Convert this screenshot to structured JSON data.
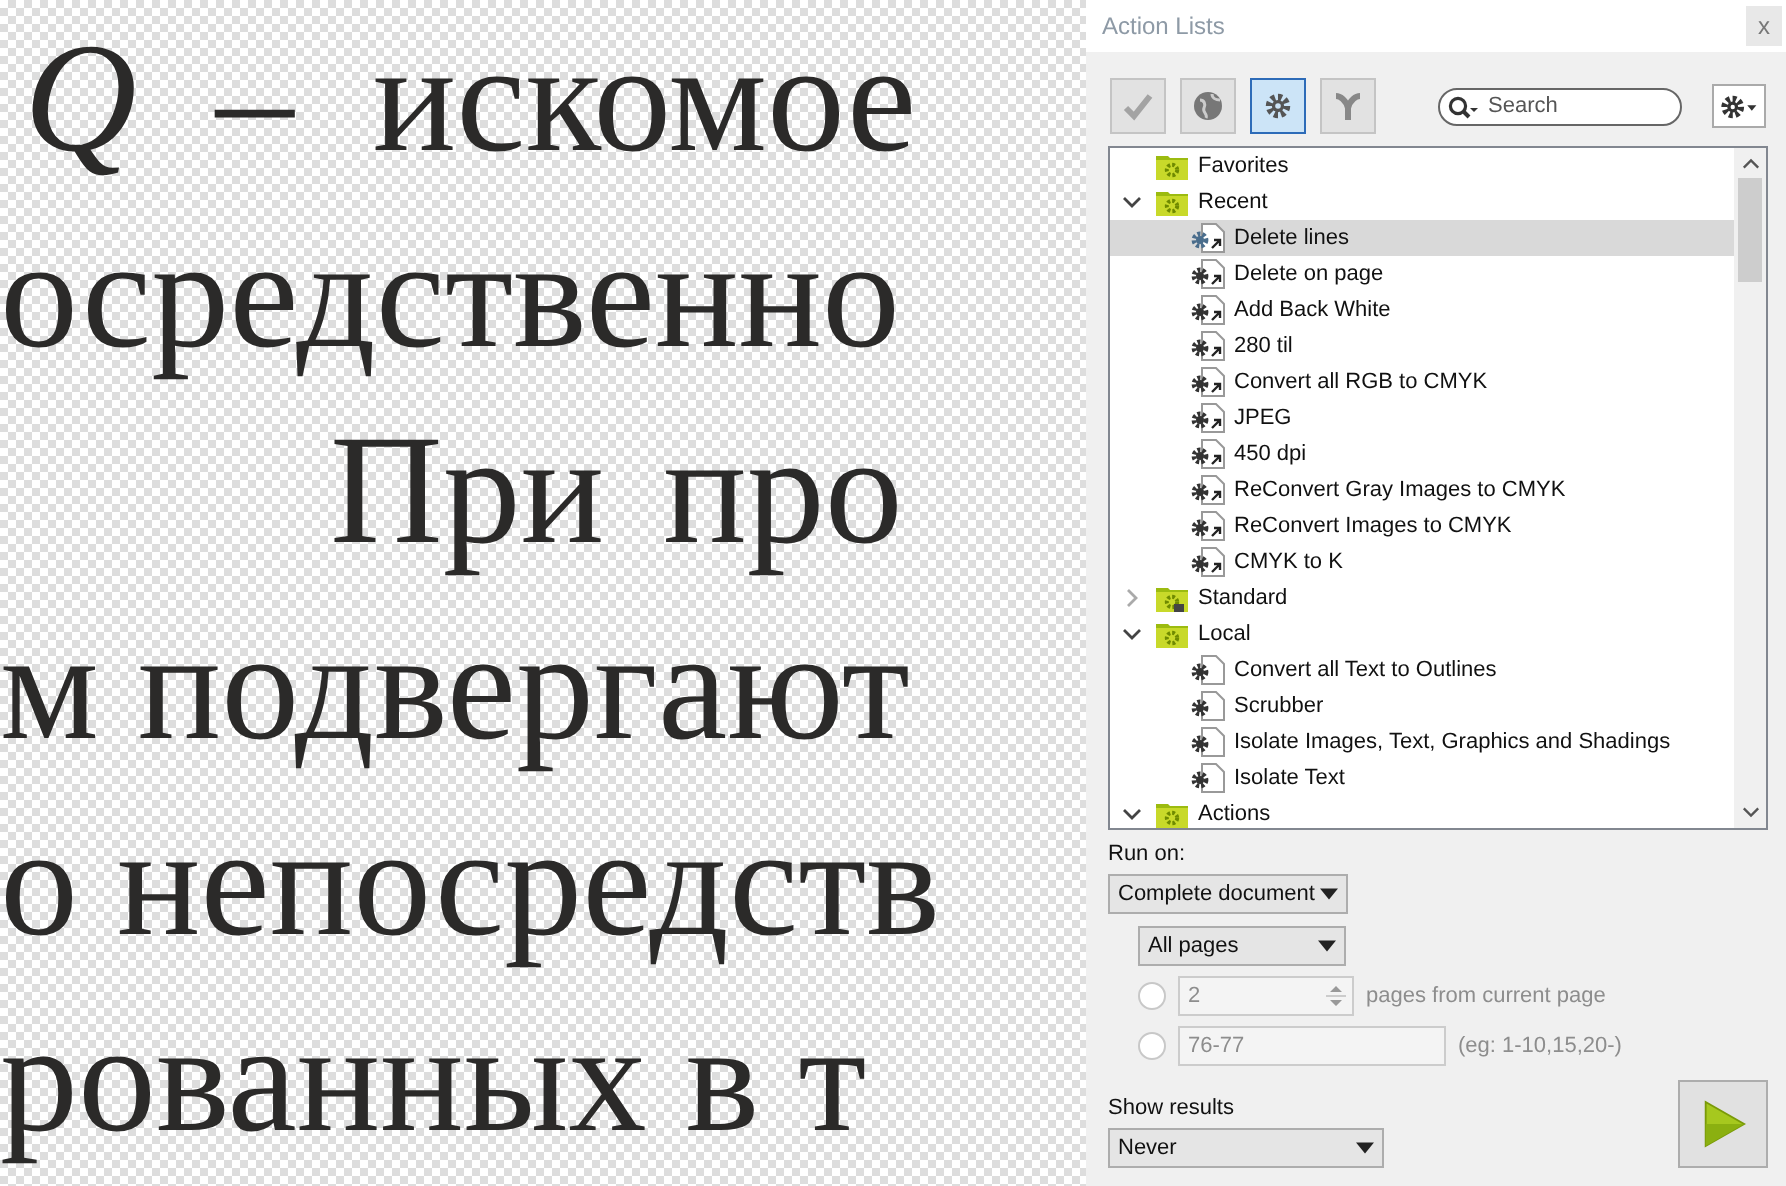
{
  "document": {
    "lines": [
      "*Q* – искомое",
      "осредственно",
      "При про",
      "м подвергают",
      "о непосредств",
      "рованных в т"
    ]
  },
  "panel": {
    "title": "Action Lists",
    "close": "x",
    "toolbar": [
      {
        "kind": "check",
        "selected": false
      },
      {
        "kind": "globe",
        "selected": false
      },
      {
        "kind": "gear",
        "selected": true
      },
      {
        "kind": "fork",
        "selected": false
      }
    ],
    "search": {
      "placeholder": "Search"
    },
    "tree": [
      {
        "label": "Favorites",
        "locked": false
      },
      {
        "label": "Recent",
        "expanded": true,
        "locked": false,
        "children": [
          {
            "label": "Delete lines",
            "kind": "shortcut",
            "selected": true
          },
          {
            "label": "Delete on page",
            "kind": "shortcut",
            "selected": false
          },
          {
            "label": "Add Back White",
            "kind": "shortcut",
            "selected": false
          },
          {
            "label": "280 til",
            "kind": "shortcut",
            "selected": false
          },
          {
            "label": "Convert all RGB to CMYK",
            "kind": "shortcut",
            "selected": false
          },
          {
            "label": "JPEG",
            "kind": "shortcut",
            "selected": false
          },
          {
            "label": "450 dpi",
            "kind": "shortcut",
            "selected": false
          },
          {
            "label": "ReConvert Gray Images to CMYK",
            "kind": "shortcut",
            "selected": false
          },
          {
            "label": "ReConvert Images to CMYK",
            "kind": "shortcut",
            "selected": false
          },
          {
            "label": "CMYK to K",
            "kind": "shortcut",
            "selected": false
          }
        ]
      },
      {
        "label": "Standard",
        "expanded": false,
        "locked": true
      },
      {
        "label": "Local",
        "expanded": true,
        "locked": false,
        "children": [
          {
            "label": "Convert all Text to Outlines",
            "kind": "action",
            "selected": false
          },
          {
            "label": "Scrubber",
            "kind": "action",
            "selected": false
          },
          {
            "label": "Isolate Images, Text, Graphics and Shadings",
            "kind": "action",
            "selected": false
          },
          {
            "label": "Isolate Text",
            "kind": "action",
            "selected": false
          }
        ]
      },
      {
        "label": "Actions",
        "expanded": true,
        "locked": false
      }
    ],
    "run_on": {
      "label": "Run on:",
      "scope": "Complete document",
      "pages": "All pages",
      "options": [
        {
          "kind": "spin",
          "value": "2",
          "suffix": "pages from current page",
          "selected": false,
          "disabled": true
        },
        {
          "kind": "range",
          "value": "76-77",
          "suffix": "(eg: 1-10,15,20-)",
          "selected": false,
          "disabled": true
        }
      ]
    },
    "show_results": {
      "label": "Show results",
      "value": "Never"
    }
  }
}
